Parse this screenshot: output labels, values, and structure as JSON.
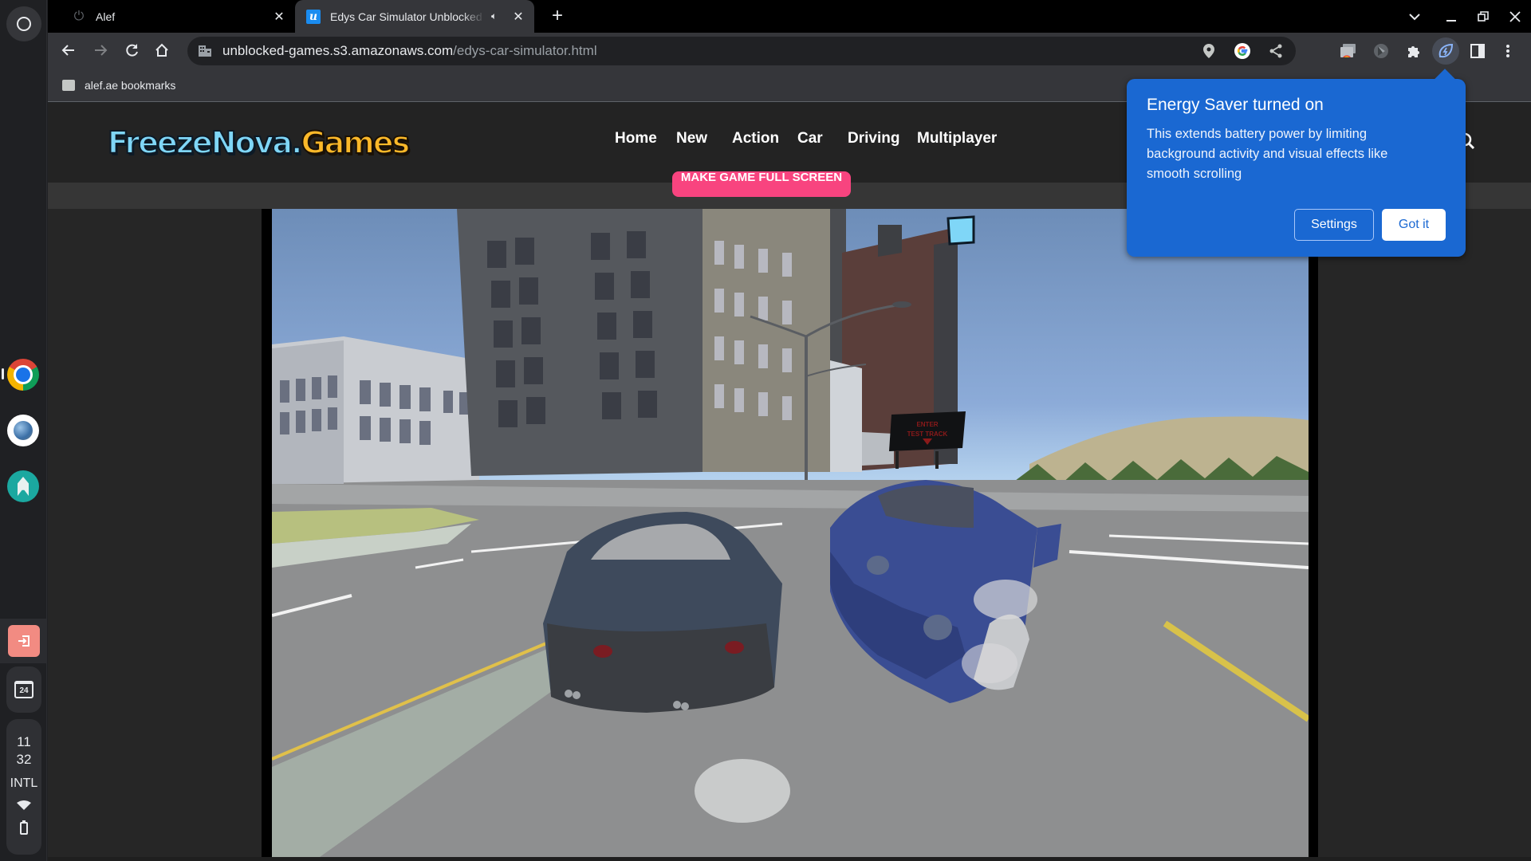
{
  "shelf": {
    "apps": [
      {
        "name": "Google Chrome",
        "icon": "chrome-icon",
        "active": true
      },
      {
        "name": "Browser",
        "icon": "globe-icon"
      },
      {
        "name": "Alef",
        "icon": "alef-icon"
      }
    ],
    "calendar_day": "24",
    "time_hour": "11",
    "time_minute": "32",
    "ime": "INTL",
    "status_icons": [
      "wifi-icon",
      "battery-icon"
    ]
  },
  "browser": {
    "tabs": [
      {
        "title": "Alef",
        "favicon": "power-icon",
        "active": false
      },
      {
        "title": "Edys Car Simulator Unblocked",
        "favicon": "u-icon",
        "active": true,
        "audio": true
      }
    ],
    "new_tab_label": "+",
    "window_controls": [
      "tab-search",
      "minimize",
      "restore",
      "close"
    ],
    "url_host": "unblocked-games.s3.amazonaws.com",
    "url_path": "/edys-car-simulator.html",
    "omnibox_icons": [
      "location-pin-icon",
      "google-icon",
      "share-icon"
    ],
    "extensions": [
      "cast-icon",
      "extension-shield-icon",
      "puzzle-icon",
      "energy-saver-icon",
      "side-panel-icon",
      "kebab-menu-icon"
    ],
    "bookmarks": [
      {
        "label": "alef.ae bookmarks"
      }
    ]
  },
  "site": {
    "logo_part1": "FreezeNova.",
    "logo_part2": "Games",
    "nav": [
      "Home",
      "New",
      "Action",
      "Car",
      "Driving",
      "Multiplayer"
    ],
    "fullscreen_button": "MAKE GAME FULL SCREEN",
    "game": {
      "title": "Edys Car Simulator",
      "billboard_line1": "ENTER",
      "billboard_line2": "TEST TRACK"
    }
  },
  "energy_saver": {
    "title": "Energy Saver turned on",
    "body": "This extends battery power by limiting background activity and visual effects like smooth scrolling",
    "settings_label": "Settings",
    "gotit_label": "Got it",
    "accent": "#1a68d2"
  }
}
